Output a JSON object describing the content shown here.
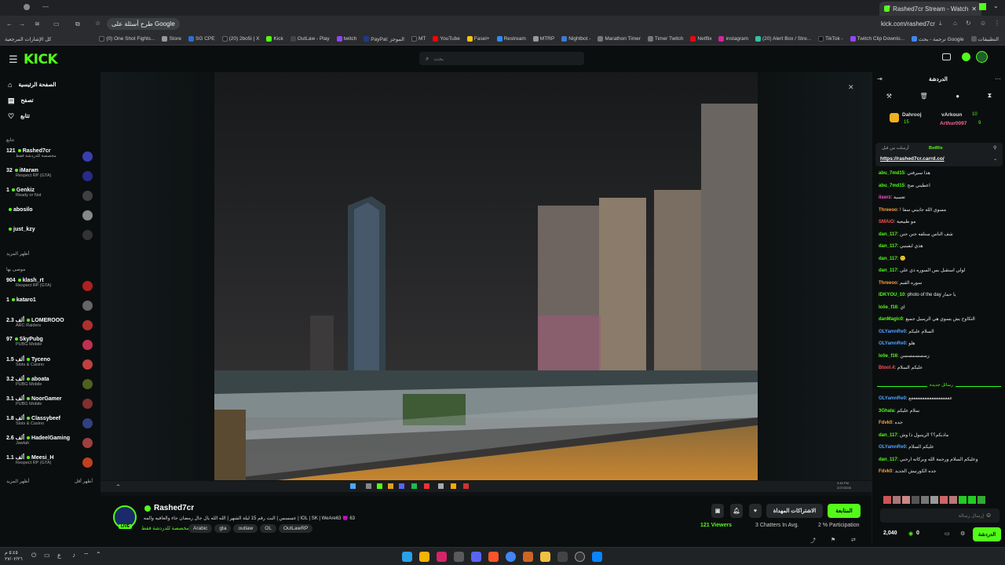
{
  "browser": {
    "tab_title": "Rashed7cr Stream - Watch",
    "url": "kick.com/rashed7cr",
    "google_chip": "طرح أسئلة على Google",
    "apps_label": "التطبيقات",
    "all_bookmarks": "كل الإشارات المرجعية",
    "bookmarks": [
      "ترجمة - بحث Google",
      "Twitch Clip Downlo...",
      "TikTok -",
      "(20) Alert Box / Stre...",
      "instagram",
      "Netflix",
      "Timer Twitch",
      "Marathon Timer",
      "Nightbot -",
      "MTRP",
      "Restream",
      "Fasel+",
      "YouTube",
      "MT",
      "PayPal: الموجز",
      "twitch",
      "OutLaw - Play",
      "Kick",
      "(20) 2bo5i | X",
      "SG CPE",
      "Store",
      "(0) One Shot Fights..."
    ]
  },
  "kick": {
    "logo": "KICK",
    "search_placeholder": "بحث"
  },
  "sidebar": {
    "nav": [
      {
        "label": "الصفحة الرئيسية",
        "icon": "home-icon"
      },
      {
        "label": "تصفح",
        "icon": "browse-icon"
      },
      {
        "label": "تتابع",
        "icon": "heart-icon"
      }
    ],
    "following_title": "تتابع",
    "following": [
      {
        "count": "121",
        "name": "Rashed7cr",
        "cat": "مخصصة للدردشة فقط",
        "color": "#3a3fb0"
      },
      {
        "count": "32",
        "name": "iMarwn",
        "cat": "Respect RP (GTA)",
        "color": "#2a2a8a"
      },
      {
        "count": "1",
        "name": "Genkiz",
        "cat": "Ready or Not",
        "color": "#404040"
      },
      {
        "count": "",
        "name": "abosilo",
        "cat": "",
        "color": "#888"
      },
      {
        "count": "",
        "name": "just_kzy",
        "cat": "",
        "color": "#333"
      }
    ],
    "show_more": "أظهر المزيد",
    "recommended_title": "موصى بها",
    "recommended": [
      {
        "count": "904",
        "name": "klash_rt",
        "cat": "Respect RP (GTA)",
        "color": "#b02020"
      },
      {
        "count": "1",
        "name": "kataro1",
        "cat": "",
        "color": "#666"
      },
      {
        "count": "2.3 ألف",
        "name": "LOMEROOO",
        "cat": "ARC Raiders",
        "color": "#b03030"
      },
      {
        "count": "97",
        "name": "SkyPubg",
        "cat": "PUBG Mobile",
        "color": "#c03050"
      },
      {
        "count": "1.5 ألف",
        "name": "Tyceno",
        "cat": "Slots & Casino",
        "color": "#c04040"
      },
      {
        "count": "3.2 ألف",
        "name": "aboata",
        "cat": "PUBG Mobile",
        "color": "#506020"
      },
      {
        "count": "3.1 ألف",
        "name": "NoorGamer",
        "cat": "PUBG Mobile",
        "color": "#803030"
      },
      {
        "count": "1.8 ألف",
        "name": "Classybeef",
        "cat": "Slots & Casino",
        "color": "#304080"
      },
      {
        "count": "2.6 ألف",
        "name": "HadeelGaming",
        "cat": "Jawlah",
        "color": "#a04040"
      },
      {
        "count": "1.1 ألف",
        "name": "Meesi_H",
        "cat": "Respect RP (GTA)",
        "color": "#c04020"
      }
    ],
    "show_more_2": "أظهر المزيد",
    "show_less": "أظهر أقل"
  },
  "stream": {
    "streamer": "Rashed7cr",
    "title": "IOL | SK | WeAre63 😈 63 | عسسس | البث رقم 15 ليلة الشهر | الله الله يال جال رمضان جاء والعافيه والمه",
    "category": "مخصصة للدردشة فقط",
    "tags": [
      "Arabic",
      "gta",
      "outlaw",
      "OL",
      "OutLawRP"
    ],
    "follow_label": "المتابعة",
    "subscribe_label": "الاشتراكات المهداة",
    "viewers": "121 Viewers",
    "chatters": "3 Chatters In Avg.",
    "participation": "2 % Participation",
    "inner_time": "3:45 PM",
    "inner_date": "2/27/2026"
  },
  "chat": {
    "title": "الدردشة",
    "top_gifters": [
      {
        "name": "Dahrooj",
        "count": "15"
      },
      {
        "name": "vArkoun",
        "count": "10"
      },
      {
        "name": "Arthur0097",
        "count": "9"
      }
    ],
    "pinned_by": "BotRix",
    "pinned_prefix": "أرسلت من قبل",
    "pinned_link": "https://rashed7cr.carrd.co/",
    "messages": [
      {
        "user": "abu_7md15",
        "text": "هذا سيرفتي",
        "color": "#53fc18"
      },
      {
        "user": "abu_7md15",
        "text": "اعطيني صح",
        "color": "#53fc18"
      },
      {
        "user": "iisorz",
        "text": "تعسية",
        "color": "#ff5ad1"
      },
      {
        "user": "Threeoo",
        "text": "! مسوي الله جايبني سفا",
        "color": "#ff9f40"
      },
      {
        "user": "SMAiO",
        "text": "مو طبيعية",
        "color": "#ff5050"
      },
      {
        "user": "dan_117",
        "text": "شف الناس ستلفه جنن جنن",
        "color": "#53fc18"
      },
      {
        "user": "dan_117",
        "text": "هذي ايفينيي",
        "color": "#53fc18"
      },
      {
        "user": "dan_117",
        "text": "🙂",
        "color": "#53fc18"
      },
      {
        "user": "dan_117",
        "text": "لولي استقبل بس السوره ذي علي",
        "color": "#53fc18"
      },
      {
        "user": "Threeoo",
        "text": "سوره القيم",
        "color": "#ff9f40"
      },
      {
        "user": "IDKYOU_10",
        "text": "photo of the day يا حمار",
        "color": "#53fc18"
      },
      {
        "user": "lolie_f16",
        "text": "اي",
        "color": "#53fc18"
      },
      {
        "user": "danMagic0",
        "text": "التكاوح يش يسوي هي الرينبيل جميع",
        "color": "#53fc18"
      },
      {
        "user": "OLYamnRe0",
        "text": "السلام عليكم",
        "color": "#4fa3ff"
      },
      {
        "user": "OLYamnRe0",
        "text": "هلو",
        "color": "#4fa3ff"
      },
      {
        "user": "lolie_f16",
        "text": "زسسسمسسن",
        "color": "#53fc18"
      },
      {
        "user": "Btool.4",
        "text": "عليكم السلام",
        "color": "#ff5050"
      }
    ],
    "new_messages": "رسائل جديدة",
    "messages2": [
      {
        "user": "OLYamnRe0",
        "text": "ععععععععععععععععععع",
        "color": "#4fa3ff"
      },
      {
        "user": "3Ghala",
        "text": "سلام عليكم",
        "color": "#53fc18"
      },
      {
        "user": "Fdvk0",
        "text": "جده",
        "color": "#ff9f40"
      },
      {
        "user": "dan_117",
        "text": "ماذبكم؟؟ الرينبول ذا وش",
        "color": "#53fc18"
      },
      {
        "user": "OLYamnRe0",
        "text": "عليكم السلام",
        "color": "#4fa3ff"
      },
      {
        "user": "dan_117",
        "text": "وعليكم السلام ورحمة الله وبركاته ارحبي",
        "color": "#53fc18"
      },
      {
        "user": "Fdvk0",
        "text": "جده الكورنيش الجديد",
        "color": "#ff9f40"
      }
    ],
    "input_placeholder": "إرسال رسالة",
    "points": "2,040",
    "points2": "0",
    "chat_button": "الدردشة"
  },
  "windows": {
    "time": "٥:٤٥ م",
    "date": "٢٧/٠٢/٢٦",
    "lang": "ع"
  }
}
